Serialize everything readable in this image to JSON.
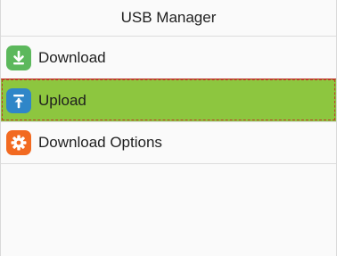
{
  "header": {
    "title": "USB Manager"
  },
  "menu": {
    "items": [
      {
        "label": "Download",
        "icon": "download-icon",
        "icon_color": "#5cb85c"
      },
      {
        "label": "Upload",
        "icon": "upload-icon",
        "icon_color": "#2f86c8",
        "selected": true
      },
      {
        "label": "Download Options",
        "icon": "gear-icon",
        "icon_color": "#f26a21"
      }
    ]
  },
  "colors": {
    "selected_row": "#8dc63f",
    "selection_border": "#c0392b"
  }
}
